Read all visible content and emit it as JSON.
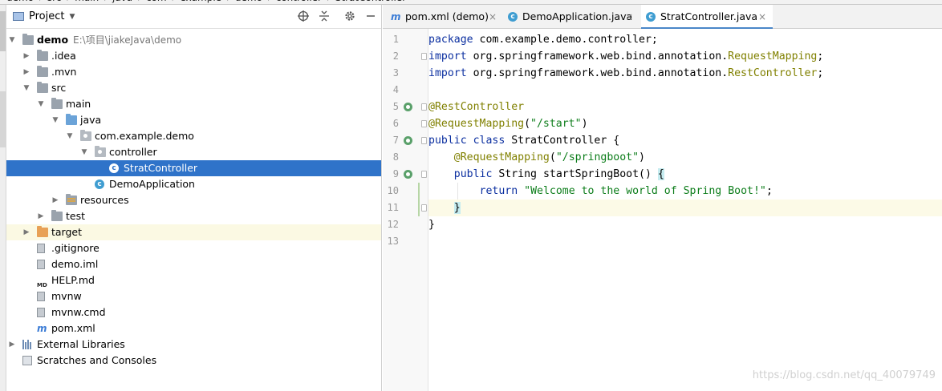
{
  "breadcrumb": [
    "demo",
    "src",
    "main",
    "java",
    "com",
    "example",
    "demo",
    "controller",
    "StratController"
  ],
  "project_panel": {
    "title": "Project",
    "tree": [
      {
        "label": "demo",
        "note": "E:\\项目\\jiakeJava\\demo",
        "level": 0,
        "expanded": true,
        "icon": "module-folder-icon"
      },
      {
        "label": ".idea",
        "level": 1,
        "expanded": false,
        "icon": "folder-icon"
      },
      {
        "label": ".mvn",
        "level": 1,
        "expanded": false,
        "icon": "folder-icon"
      },
      {
        "label": "src",
        "level": 1,
        "expanded": true,
        "icon": "folder-icon"
      },
      {
        "label": "main",
        "level": 2,
        "expanded": true,
        "icon": "folder-icon"
      },
      {
        "label": "java",
        "level": 3,
        "expanded": true,
        "icon": "source-folder-icon"
      },
      {
        "label": "com.example.demo",
        "level": 4,
        "expanded": true,
        "icon": "package-icon"
      },
      {
        "label": "controller",
        "level": 5,
        "expanded": true,
        "icon": "package-icon"
      },
      {
        "label": "StratController",
        "level": 6,
        "icon": "class-icon",
        "selected": true
      },
      {
        "label": "DemoApplication",
        "level": 5,
        "icon": "spring-class-icon"
      },
      {
        "label": "resources",
        "level": 3,
        "expanded": false,
        "icon": "resources-folder-icon"
      },
      {
        "label": "test",
        "level": 2,
        "expanded": false,
        "icon": "folder-icon"
      },
      {
        "label": "target",
        "level": 1,
        "expanded": false,
        "icon": "excluded-folder-icon",
        "highlight": true
      },
      {
        "label": ".gitignore",
        "level": 1,
        "icon": "file-icon"
      },
      {
        "label": "demo.iml",
        "level": 1,
        "icon": "file-icon"
      },
      {
        "label": "HELP.md",
        "level": 1,
        "icon": "markdown-icon"
      },
      {
        "label": "mvnw",
        "level": 1,
        "icon": "file-icon"
      },
      {
        "label": "mvnw.cmd",
        "level": 1,
        "icon": "file-icon"
      },
      {
        "label": "pom.xml",
        "level": 1,
        "icon": "maven-icon"
      },
      {
        "label": "External Libraries",
        "level": 0,
        "expanded": false,
        "icon": "libraries-icon"
      },
      {
        "label": "Scratches and Consoles",
        "level": 0,
        "icon": "scratches-icon"
      }
    ]
  },
  "tabs": [
    {
      "label": "pom.xml (demo)",
      "icon": "maven-icon",
      "active": false
    },
    {
      "label": "DemoApplication.java",
      "icon": "spring-class-icon",
      "active": false
    },
    {
      "label": "StratController.java",
      "icon": "class-icon",
      "active": true
    }
  ],
  "code_lines": [
    {
      "n": "1",
      "tokens": [
        [
          "kw",
          "package"
        ],
        [
          "t",
          " com.example.demo.controller;"
        ]
      ]
    },
    {
      "n": "2",
      "tokens": [
        [
          "kw",
          "import"
        ],
        [
          "t",
          " org.springframework.web.bind.annotation."
        ],
        [
          "ann",
          "RequestMapping"
        ],
        [
          "t",
          ";"
        ]
      ]
    },
    {
      "n": "3",
      "tokens": [
        [
          "kw",
          "import"
        ],
        [
          "t",
          " org.springframework.web.bind.annotation."
        ],
        [
          "ann",
          "RestController"
        ],
        [
          "t",
          ";"
        ]
      ]
    },
    {
      "n": "4",
      "tokens": []
    },
    {
      "n": "5",
      "tokens": [
        [
          "ann",
          "@RestController"
        ]
      ]
    },
    {
      "n": "6",
      "tokens": [
        [
          "ann",
          "@RequestMapping"
        ],
        [
          "t",
          "("
        ],
        [
          "str",
          "\"/start\""
        ],
        [
          "t",
          ")"
        ]
      ]
    },
    {
      "n": "7",
      "tokens": [
        [
          "kw",
          "public class"
        ],
        [
          "t",
          " StratController {"
        ]
      ]
    },
    {
      "n": "8",
      "tokens": [
        [
          "t",
          "    "
        ],
        [
          "ann",
          "@RequestMapping"
        ],
        [
          "t",
          "("
        ],
        [
          "str",
          "\"/springboot\""
        ],
        [
          "t",
          ")"
        ]
      ]
    },
    {
      "n": "9",
      "tokens": [
        [
          "t",
          "    "
        ],
        [
          "kw",
          "public"
        ],
        [
          "t",
          " String "
        ],
        [
          "t",
          "startSpringBoot() "
        ],
        [
          "brace",
          "{"
        ]
      ]
    },
    {
      "n": "10",
      "tokens": [
        [
          "t",
          "        "
        ],
        [
          "kw",
          "return"
        ],
        [
          "t",
          " "
        ],
        [
          "str",
          "\"Welcome to the world of Spring Boot!\""
        ],
        [
          "t",
          ";"
        ]
      ]
    },
    {
      "n": "11",
      "tokens": [
        [
          "t",
          "    "
        ],
        [
          "brace",
          "}"
        ]
      ]
    },
    {
      "n": "12",
      "tokens": [
        [
          "t",
          "}"
        ]
      ]
    },
    {
      "n": "13",
      "tokens": []
    }
  ],
  "watermark": "https://blog.csdn.net/qq_40079749"
}
